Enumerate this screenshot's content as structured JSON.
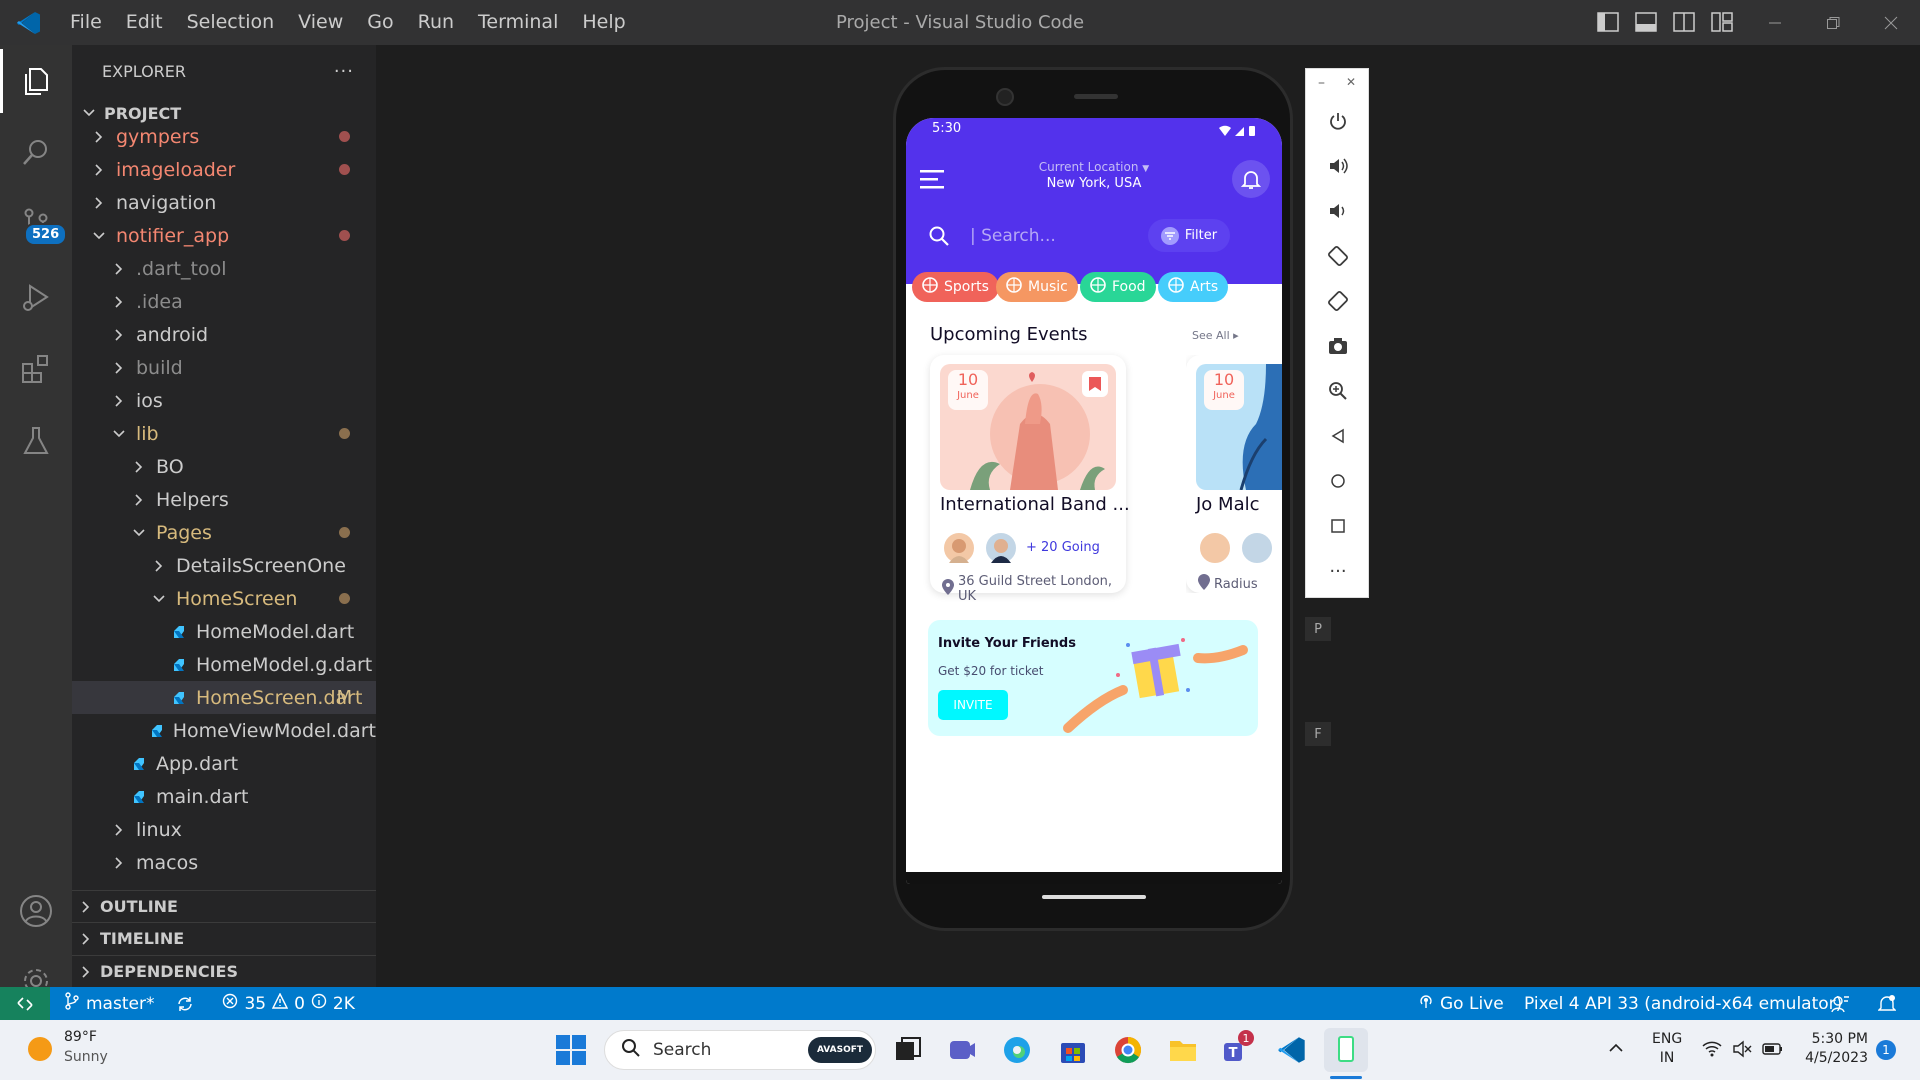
{
  "window": {
    "title": "Project - Visual Studio Code"
  },
  "menu": [
    "File",
    "Edit",
    "Selection",
    "View",
    "Go",
    "Run",
    "Terminal",
    "Help"
  ],
  "activity": {
    "scm_badge": "526"
  },
  "explorer": {
    "title": "EXPLORER",
    "more": "···",
    "project": "PROJECT",
    "items": [
      {
        "label": "gympers",
        "color": "#f48771",
        "indent": 0,
        "kind": "folder",
        "open": false,
        "mark": "dot-red"
      },
      {
        "label": "imageloader",
        "color": "#f48771",
        "indent": 0,
        "kind": "folder",
        "open": false,
        "mark": "dot-red"
      },
      {
        "label": "navigation",
        "color": "#cccccc",
        "indent": 0,
        "kind": "folder",
        "open": false,
        "mark": ""
      },
      {
        "label": "notifier_app",
        "color": "#f48771",
        "indent": 0,
        "kind": "folder",
        "open": true,
        "mark": "dot-red"
      },
      {
        "label": ".dart_tool",
        "color": "#8c8c8c",
        "indent": 1,
        "kind": "folder",
        "open": false,
        "mark": ""
      },
      {
        "label": ".idea",
        "color": "#8c8c8c",
        "indent": 1,
        "kind": "folder",
        "open": false,
        "mark": ""
      },
      {
        "label": "android",
        "color": "#cccccc",
        "indent": 1,
        "kind": "folder",
        "open": false,
        "mark": ""
      },
      {
        "label": "build",
        "color": "#8c8c8c",
        "indent": 1,
        "kind": "folder",
        "open": false,
        "mark": ""
      },
      {
        "label": "ios",
        "color": "#cccccc",
        "indent": 1,
        "kind": "folder",
        "open": false,
        "mark": ""
      },
      {
        "label": "lib",
        "color": "#d7ba7d",
        "indent": 1,
        "kind": "folder",
        "open": true,
        "mark": "dot-yellow"
      },
      {
        "label": "BO",
        "color": "#cccccc",
        "indent": 2,
        "kind": "folder",
        "open": false,
        "mark": ""
      },
      {
        "label": "Helpers",
        "color": "#cccccc",
        "indent": 2,
        "kind": "folder",
        "open": false,
        "mark": ""
      },
      {
        "label": "Pages",
        "color": "#d7ba7d",
        "indent": 2,
        "kind": "folder",
        "open": true,
        "mark": "dot-yellow"
      },
      {
        "label": "DetailsScreenOne",
        "color": "#cccccc",
        "indent": 3,
        "kind": "folder",
        "open": false,
        "mark": ""
      },
      {
        "label": "HomeScreen",
        "color": "#d7ba7d",
        "indent": 3,
        "kind": "folder",
        "open": true,
        "mark": "dot-yellow"
      },
      {
        "label": "HomeModel.dart",
        "color": "#cccccc",
        "indent": 4,
        "kind": "file",
        "mark": ""
      },
      {
        "label": "HomeModel.g.dart",
        "color": "#cccccc",
        "indent": 4,
        "kind": "file",
        "mark": ""
      },
      {
        "label": "HomeScreen.dart",
        "color": "#d7ba7d",
        "indent": 4,
        "kind": "file",
        "mark": "M",
        "selected": true
      },
      {
        "label": "HomeViewModel.dart",
        "color": "#cccccc",
        "indent": 4,
        "kind": "file",
        "mark": ""
      },
      {
        "label": "App.dart",
        "color": "#cccccc",
        "indent": 2,
        "kind": "file",
        "mark": ""
      },
      {
        "label": "main.dart",
        "color": "#cccccc",
        "indent": 2,
        "kind": "file",
        "mark": ""
      },
      {
        "label": "linux",
        "color": "#cccccc",
        "indent": 1,
        "kind": "folder",
        "open": false,
        "mark": ""
      },
      {
        "label": "macos",
        "color": "#cccccc",
        "indent": 1,
        "kind": "folder",
        "open": false,
        "mark": ""
      }
    ]
  },
  "panels": {
    "outline": "OUTLINE",
    "timeline": "TIMELINE",
    "dependencies": "DEPENDENCIES"
  },
  "phone": {
    "time": "5:30",
    "location_label": "Current Location",
    "location": "New York, USA",
    "search_placeholder": "| Search...",
    "filter": "Filter",
    "chips": [
      {
        "label": "Sports",
        "color": "#f0635a"
      },
      {
        "label": "Music",
        "color": "#f59762"
      },
      {
        "label": "Food",
        "color": "#29d697"
      },
      {
        "label": "Arts",
        "color": "#46cdfb"
      }
    ],
    "section_title": "Upcoming Events",
    "see_all": "See All",
    "events": [
      {
        "day": "10",
        "month": "June",
        "title": "International Band ...",
        "going": "+ 20 Going",
        "address": "36 Guild Street London, UK"
      },
      {
        "day": "10",
        "month": "June",
        "title": "Jo Malc",
        "address": "Radius"
      }
    ],
    "invite": {
      "title": "Invite Your Friends",
      "subtitle": "Get $20 for ticket",
      "button": "INVITE"
    }
  },
  "emulator": {
    "side_labels": [
      "P",
      "F"
    ]
  },
  "statusbar": {
    "branch": "master*",
    "errors": "35",
    "warnings": "0",
    "info": "2K",
    "golive": "Go Live",
    "device": "Pixel 4 API 33 (android-x64 emulator)"
  },
  "taskbar": {
    "temp": "89°F",
    "weather": "Sunny",
    "search": "Search",
    "lang1": "ENG",
    "lang2": "IN",
    "time": "5:30 PM",
    "date": "4/5/2023",
    "notif": "1",
    "teams_badge": "1",
    "pill": "AVASOFT"
  }
}
